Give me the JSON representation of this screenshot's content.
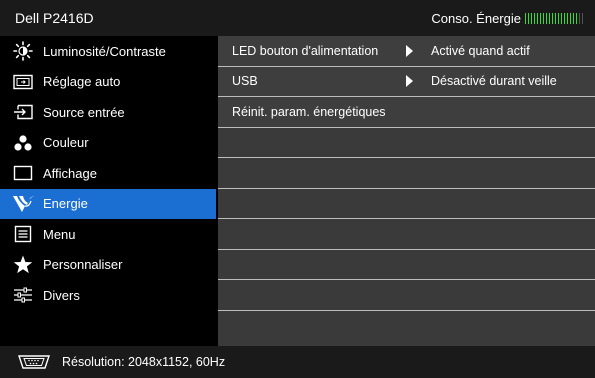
{
  "header": {
    "model": "Dell P2416D",
    "energy_label": "Conso. Énergie",
    "energy_meter_level": 0.9
  },
  "sidebar": {
    "items": [
      {
        "label": "Luminosité/Contraste",
        "icon": "brightness-icon"
      },
      {
        "label": "Réglage auto",
        "icon": "auto-adjust-icon"
      },
      {
        "label": "Source entrée",
        "icon": "input-source-icon"
      },
      {
        "label": "Couleur",
        "icon": "color-icon"
      },
      {
        "label": "Affichage",
        "icon": "display-icon"
      },
      {
        "label": "Energie",
        "icon": "energy-icon",
        "active": true
      },
      {
        "label": "Menu",
        "icon": "menu-icon"
      },
      {
        "label": "Personnaliser",
        "icon": "star-icon"
      },
      {
        "label": "Divers",
        "icon": "others-icon"
      }
    ]
  },
  "panel": {
    "rows": [
      {
        "label": "LED bouton d'alimentation",
        "value": "Activé quand actif",
        "has_arrow": true
      },
      {
        "label": "USB",
        "value": "Désactivé durant veille",
        "has_arrow": true
      },
      {
        "label": "Réinit. param. énergétiques",
        "value": "",
        "has_arrow": false
      }
    ]
  },
  "footer": {
    "resolution": "Résolution: 2048x1152, 60Hz",
    "icon": "vga-connector-icon"
  },
  "colors": {
    "accent": "#1b6fd2",
    "energy_meter": "#33dd33"
  }
}
